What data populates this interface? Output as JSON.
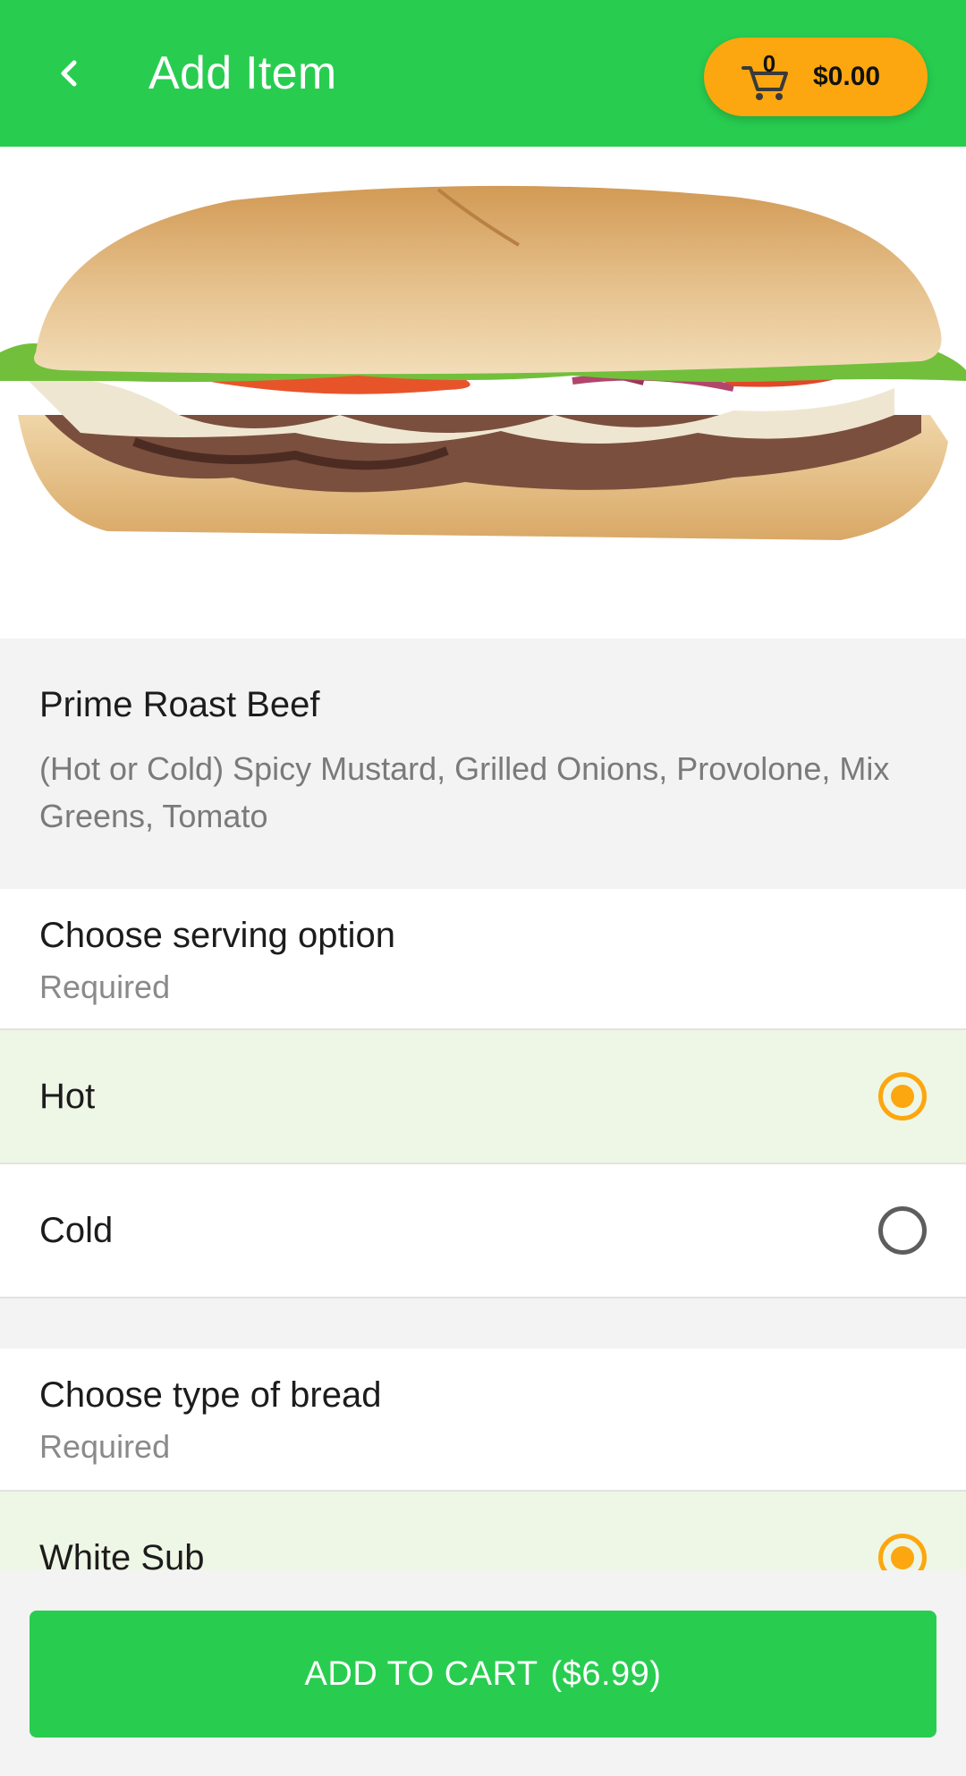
{
  "header": {
    "title": "Add Item",
    "back_icon": "chevron-left-icon",
    "cart": {
      "count": "0",
      "total": "$0.00",
      "icon": "shopping-cart-icon"
    },
    "color": "#28cd50",
    "cart_color": "#fca70f"
  },
  "item": {
    "name": "Prime Roast Beef",
    "description": "(Hot or Cold) Spicy Mustard, Grilled Onions, Provolone, Mix Greens, Tomato"
  },
  "sections": [
    {
      "title": "Choose serving option",
      "subtitle": "Required",
      "options": [
        {
          "label": "Hot",
          "selected": true
        },
        {
          "label": "Cold",
          "selected": false
        }
      ]
    },
    {
      "title": "Choose type of bread",
      "subtitle": "Required",
      "options": [
        {
          "label": "White Sub",
          "selected": true
        }
      ]
    }
  ],
  "add_to_cart": {
    "label": "ADD TO CART",
    "price": "($6.99)"
  }
}
